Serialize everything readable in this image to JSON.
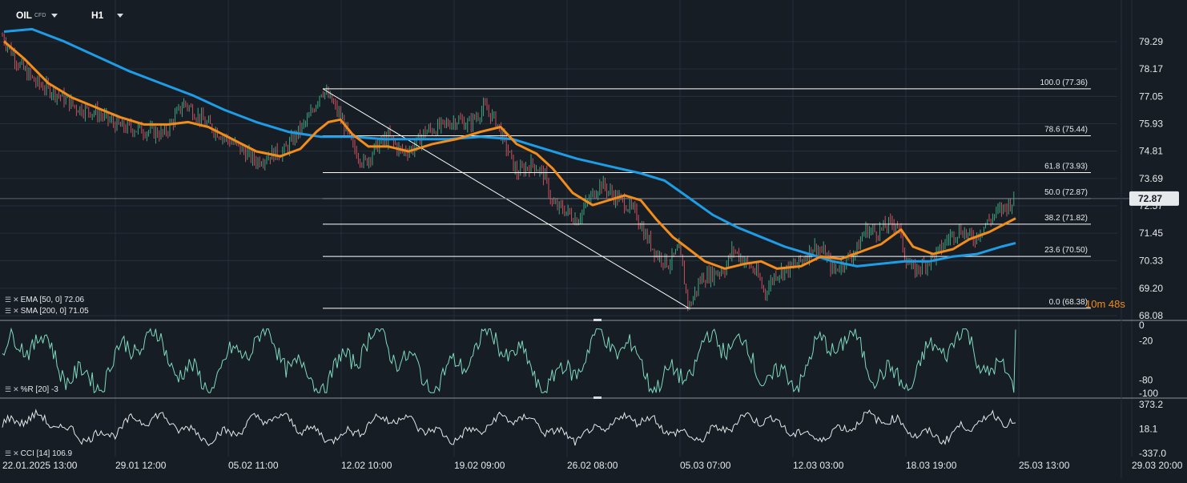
{
  "header": {
    "symbol": "OIL",
    "symbol_sub": "CFD",
    "timeframe": "H1"
  },
  "countdown": "10m 48s",
  "colors": {
    "background": "#161d24",
    "grid": "#24303b",
    "ema": "#f28c1b",
    "sma": "#1e9de6",
    "oscillator": "#7fd9bf",
    "cci": "#e6e9ec",
    "fib": "#ffffff",
    "candle_up": "#3fb68b",
    "candle_down": "#e05563"
  },
  "legends": {
    "ema": "EMA [50, 0] 72.06",
    "sma": "SMA [200, 0] 71.05",
    "wr": "%R [20] -3",
    "cci": "CCI [14] 106.9"
  },
  "chart_data": [
    {
      "type": "line",
      "title": "OIL CFD H1",
      "x_tick_labels": [
        "22.01.2025 13:00",
        "29.01 12:00",
        "05.02 11:00",
        "12.02 10:00",
        "19.02 09:00",
        "26.02 08:00",
        "05.03 07:00",
        "12.03 03:00",
        "18.03 19:00",
        "25.03 13:00",
        "29.03 20:00"
      ],
      "y_tick_labels": [
        "79.29",
        "78.17",
        "77.05",
        "75.93",
        "74.81",
        "73.69",
        "72.57",
        "71.45",
        "70.33",
        "69.20",
        "68.08"
      ],
      "ylim": [
        68.08,
        79.29
      ],
      "last_price": "72.87",
      "price_path": [
        [
          0,
          79.7
        ],
        [
          12,
          79.0
        ],
        [
          25,
          78.3
        ],
        [
          45,
          77.6
        ],
        [
          70,
          77.2
        ],
        [
          95,
          76.6
        ],
        [
          120,
          76.4
        ],
        [
          150,
          75.8
        ],
        [
          175,
          75.7
        ],
        [
          205,
          75.5
        ],
        [
          230,
          76.8
        ],
        [
          255,
          76.0
        ],
        [
          280,
          75.4
        ],
        [
          300,
          74.9
        ],
        [
          320,
          74.4
        ],
        [
          340,
          74.7
        ],
        [
          355,
          74.8
        ],
        [
          370,
          75.5
        ],
        [
          385,
          76.1
        ],
        [
          402,
          77.36
        ],
        [
          415,
          76.8
        ],
        [
          428,
          76.0
        ],
        [
          440,
          75.0
        ],
        [
          455,
          74.3
        ],
        [
          470,
          75.0
        ],
        [
          485,
          75.4
        ],
        [
          500,
          74.8
        ],
        [
          515,
          74.9
        ],
        [
          530,
          75.6
        ],
        [
          550,
          75.8
        ],
        [
          570,
          76.1
        ],
        [
          585,
          75.9
        ],
        [
          605,
          76.6
        ],
        [
          620,
          76.0
        ],
        [
          632,
          75.0
        ],
        [
          645,
          73.9
        ],
        [
          665,
          74.3
        ],
        [
          680,
          73.8
        ],
        [
          690,
          72.6
        ],
        [
          705,
          72.4
        ],
        [
          720,
          72.0
        ],
        [
          735,
          72.8
        ],
        [
          750,
          73.5
        ],
        [
          765,
          73.0
        ],
        [
          780,
          72.7
        ],
        [
          795,
          72.2
        ],
        [
          805,
          71.4
        ],
        [
          820,
          70.6
        ],
        [
          835,
          70.2
        ],
        [
          848,
          70.8
        ],
        [
          860,
          68.38
        ],
        [
          875,
          69.6
        ],
        [
          890,
          69.8
        ],
        [
          905,
          70.0
        ],
        [
          915,
          70.8
        ],
        [
          930,
          70.3
        ],
        [
          945,
          69.8
        ],
        [
          955,
          69.0
        ],
        [
          968,
          69.8
        ],
        [
          985,
          70.0
        ],
        [
          1000,
          70.3
        ],
        [
          1015,
          70.9
        ],
        [
          1030,
          70.6
        ],
        [
          1040,
          69.9
        ],
        [
          1055,
          70.3
        ],
        [
          1070,
          70.8
        ],
        [
          1080,
          71.6
        ],
        [
          1095,
          71.5
        ],
        [
          1110,
          71.8
        ],
        [
          1120,
          71.9
        ],
        [
          1130,
          70.5
        ],
        [
          1140,
          69.9
        ],
        [
          1155,
          70.2
        ],
        [
          1170,
          70.6
        ],
        [
          1185,
          71.3
        ],
        [
          1200,
          71.6
        ],
        [
          1215,
          71.2
        ],
        [
          1230,
          71.8
        ],
        [
          1245,
          72.3
        ],
        [
          1258,
          72.6
        ],
        [
          1268,
          72.87
        ]
      ],
      "series": [
        {
          "name": "EMA [50, 0] 72.06",
          "values": [
            [
              5,
              79.3
            ],
            [
              30,
              78.6
            ],
            [
              60,
              77.6
            ],
            [
              90,
              77.0
            ],
            [
              120,
              76.6
            ],
            [
              150,
              76.2
            ],
            [
              180,
              75.9
            ],
            [
              210,
              75.9
            ],
            [
              235,
              76.0
            ],
            [
              260,
              75.8
            ],
            [
              290,
              75.3
            ],
            [
              320,
              74.8
            ],
            [
              350,
              74.6
            ],
            [
              375,
              74.9
            ],
            [
              395,
              75.6
            ],
            [
              410,
              76.0
            ],
            [
              425,
              76.1
            ],
            [
              440,
              75.5
            ],
            [
              460,
              75.0
            ],
            [
              485,
              75.0
            ],
            [
              510,
              74.8
            ],
            [
              540,
              75.1
            ],
            [
              570,
              75.3
            ],
            [
              600,
              75.6
            ],
            [
              625,
              75.8
            ],
            [
              645,
              75.1
            ],
            [
              670,
              74.7
            ],
            [
              690,
              74.1
            ],
            [
              715,
              73.1
            ],
            [
              740,
              72.6
            ],
            [
              760,
              72.8
            ],
            [
              780,
              73.0
            ],
            [
              800,
              72.8
            ],
            [
              820,
              72.0
            ],
            [
              840,
              71.3
            ],
            [
              860,
              70.8
            ],
            [
              880,
              70.3
            ],
            [
              905,
              70.0
            ],
            [
              930,
              70.2
            ],
            [
              950,
              70.3
            ],
            [
              970,
              70.0
            ],
            [
              1000,
              70.1
            ],
            [
              1025,
              70.5
            ],
            [
              1050,
              70.4
            ],
            [
              1075,
              70.7
            ],
            [
              1100,
              71.0
            ],
            [
              1125,
              71.6
            ],
            [
              1140,
              70.9
            ],
            [
              1165,
              70.6
            ],
            [
              1190,
              70.8
            ],
            [
              1210,
              71.2
            ],
            [
              1235,
              71.5
            ],
            [
              1268,
              72.06
            ]
          ]
        },
        {
          "name": "SMA [200, 0] 71.05",
          "values": [
            [
              5,
              79.7
            ],
            [
              40,
              79.8
            ],
            [
              80,
              79.3
            ],
            [
              120,
              78.7
            ],
            [
              160,
              78.1
            ],
            [
              200,
              77.6
            ],
            [
              240,
              77.1
            ],
            [
              280,
              76.5
            ],
            [
              320,
              76.0
            ],
            [
              360,
              75.6
            ],
            [
              400,
              75.4
            ],
            [
              440,
              75.4
            ],
            [
              480,
              75.3
            ],
            [
              520,
              75.3
            ],
            [
              560,
              75.3
            ],
            [
              600,
              75.4
            ],
            [
              640,
              75.3
            ],
            [
              680,
              74.9
            ],
            [
              720,
              74.5
            ],
            [
              760,
              74.2
            ],
            [
              800,
              73.9
            ],
            [
              830,
              73.6
            ],
            [
              860,
              72.9
            ],
            [
              890,
              72.2
            ],
            [
              920,
              71.7
            ],
            [
              950,
              71.3
            ],
            [
              980,
              70.9
            ],
            [
              1010,
              70.6
            ],
            [
              1040,
              70.3
            ],
            [
              1070,
              70.1
            ],
            [
              1100,
              70.2
            ],
            [
              1130,
              70.3
            ],
            [
              1160,
              70.3
            ],
            [
              1190,
              70.5
            ],
            [
              1220,
              70.6
            ],
            [
              1250,
              70.9
            ],
            [
              1268,
              71.05
            ]
          ]
        }
      ],
      "fibonacci": [
        {
          "label": "100.0 (77.36)",
          "value": 77.36
        },
        {
          "label": "78.6 (75.44)",
          "value": 75.44
        },
        {
          "label": "61.8 (73.93)",
          "value": 73.93
        },
        {
          "label": "50.0 (72.87)",
          "value": 72.87
        },
        {
          "label": "38.2 (71.82)",
          "value": 71.82
        },
        {
          "label": "23.6 (70.50)",
          "value": 70.5
        },
        {
          "label": "0.0 (68.38)",
          "value": 68.38
        }
      ]
    },
    {
      "type": "line",
      "title": "%R [20] -3",
      "y_tick_labels": [
        "0",
        "-20",
        "-80",
        "-100"
      ],
      "ylim": [
        -100,
        0
      ],
      "last_value": -3
    },
    {
      "type": "line",
      "title": "CCI [14] 106.9",
      "y_tick_labels": [
        "373.2",
        "18.1",
        "-337.0"
      ],
      "ylim": [
        -337.0,
        373.2
      ],
      "last_value": 106.9
    }
  ]
}
